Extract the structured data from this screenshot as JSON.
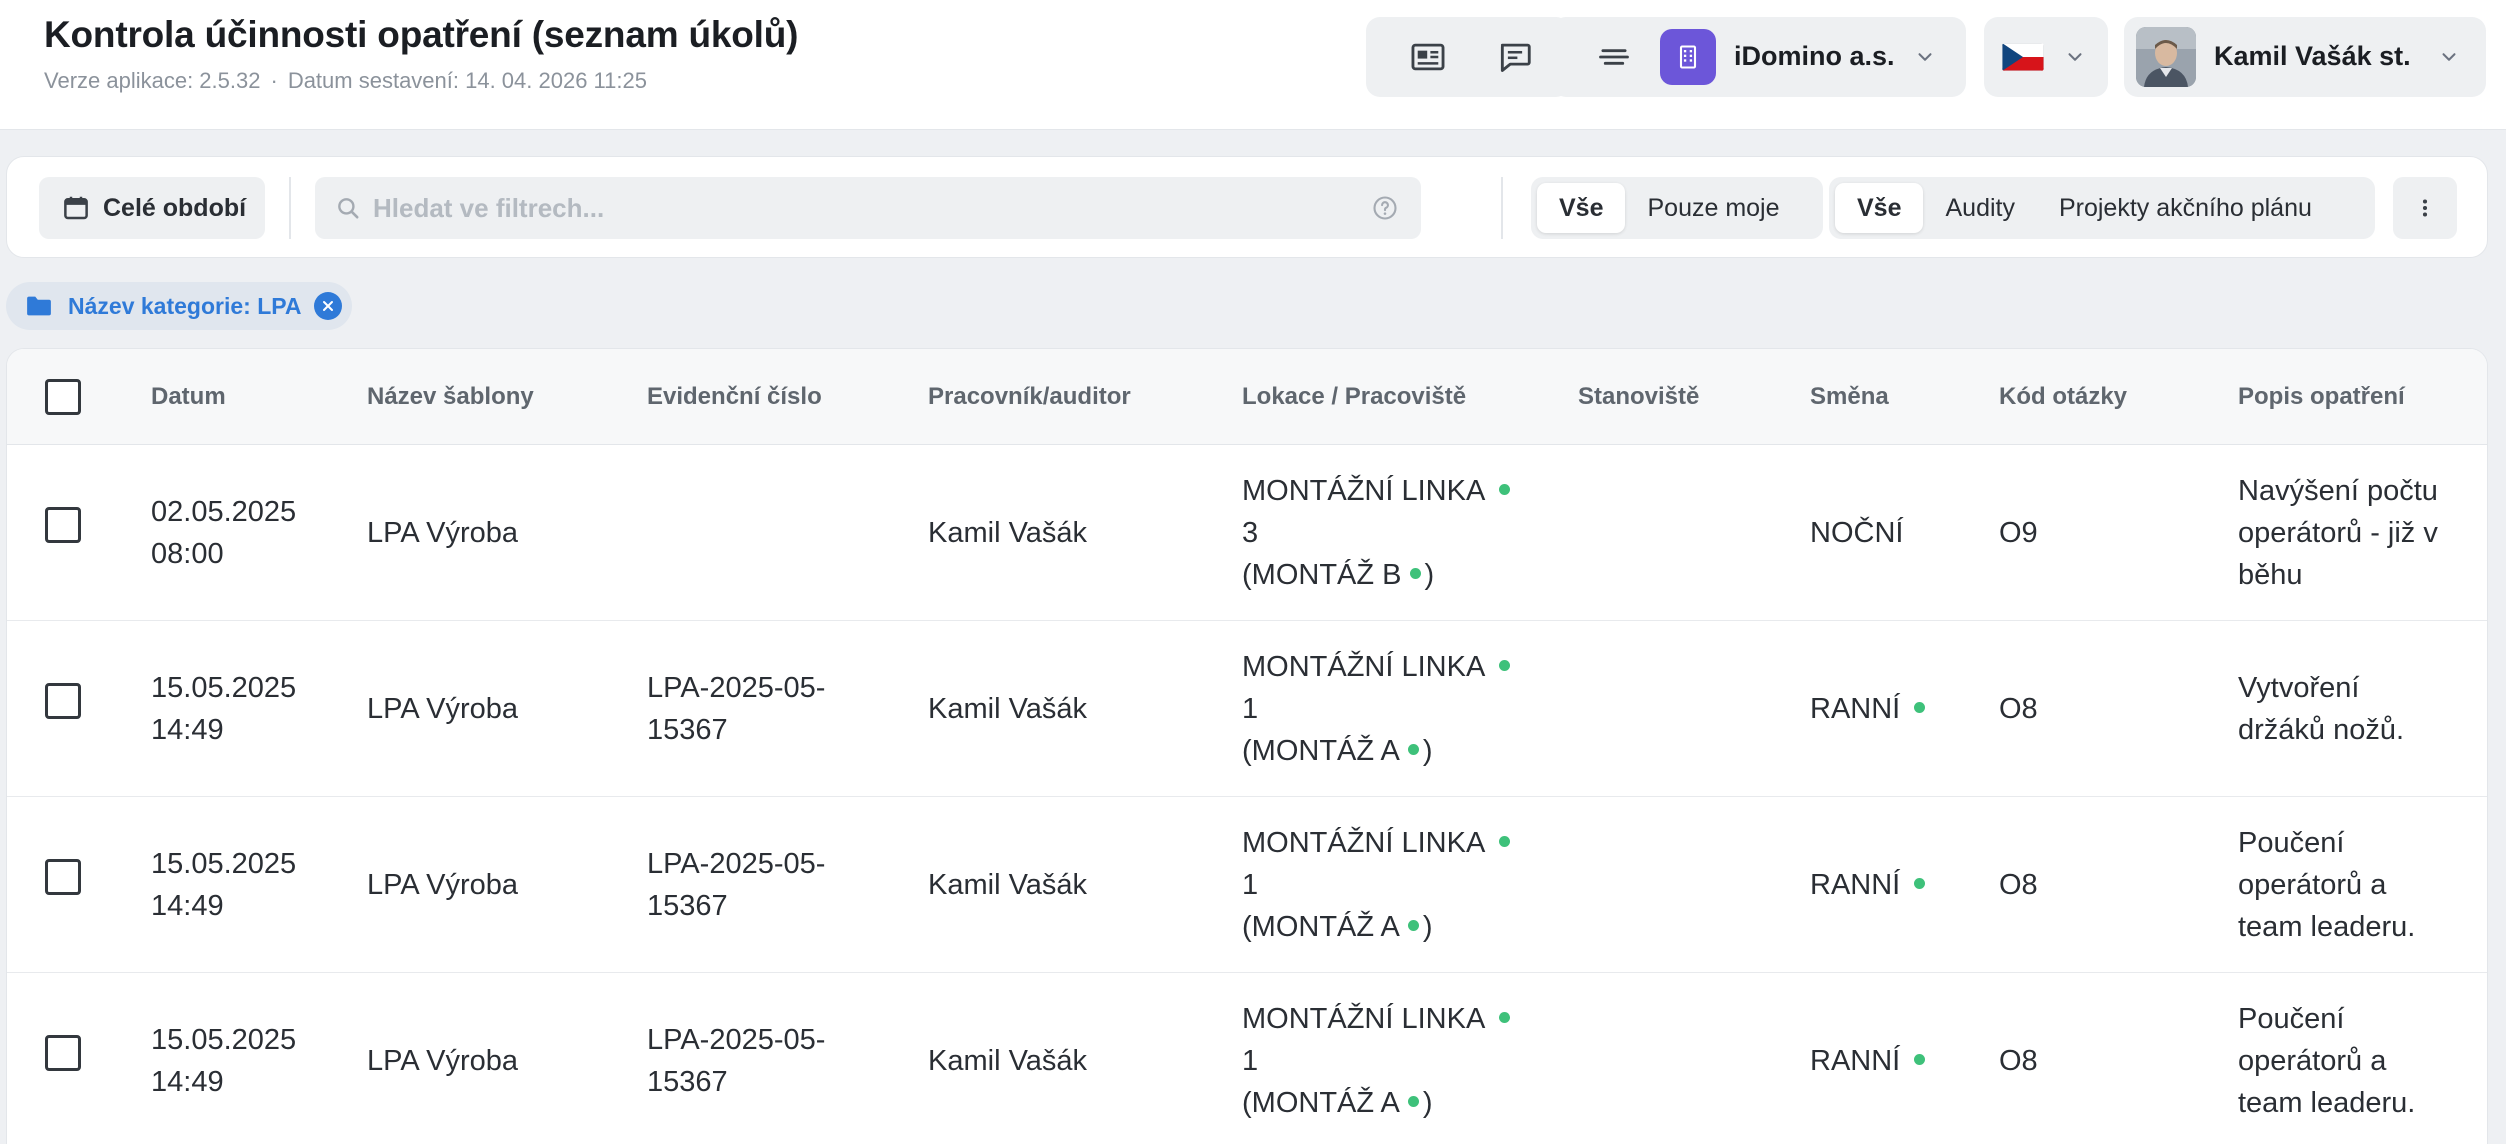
{
  "header": {
    "title": "Kontrola účinnosti opatření (seznam úkolů)",
    "app_version": "Verze aplikace: 2.5.32",
    "build_date": "Datum sestavení: 14. 04. 2026 11:25",
    "separator": "·",
    "organization": "iDomino a.s.",
    "user_name": "Kamil Vašák st.",
    "language_flag": "cz-flag-icon"
  },
  "filters": {
    "period_label": "Celé období",
    "search_placeholder": "Hledat ve filtrech...",
    "scope_toggle": [
      {
        "label": "Vše",
        "active": true
      },
      {
        "label": "Pouze moje",
        "active": false
      }
    ],
    "type_toggle": [
      {
        "label": "Vše",
        "active": true
      },
      {
        "label": "Audity",
        "active": false
      },
      {
        "label": "Projekty akčního plánu",
        "active": false
      }
    ],
    "active_chip": "Název kategorie: LPA"
  },
  "table": {
    "columns": [
      "Datum",
      "Název šablony",
      "Evidenční číslo",
      "Pracovník/auditor",
      "Lokace / Pracoviště",
      "Stanoviště",
      "Směna",
      "Kód otázky",
      "Popis opatření"
    ],
    "rows": [
      {
        "date": "02.05.2025",
        "time": "08:00",
        "template": "LPA Výroba",
        "evid_1": "",
        "evid_2": "",
        "worker": "Kamil Vašák",
        "loc_1": "MONTÁŽNÍ LINKA",
        "loc_2": "3",
        "loc_3a": "(MONTÁŽ B",
        "loc_3b": ")",
        "station": "",
        "shift": "NOČNÍ",
        "shift_dot": false,
        "code": "O9",
        "desc_1": "Navýšení počtu",
        "desc_2": "operátorů - již v",
        "desc_3": "běhu"
      },
      {
        "date": "15.05.2025",
        "time": "14:49",
        "template": "LPA Výroba",
        "evid_1": "LPA-2025-05-",
        "evid_2": "15367",
        "worker": "Kamil Vašák",
        "loc_1": "MONTÁŽNÍ LINKA",
        "loc_2": "1",
        "loc_3a": "(MONTÁŽ A",
        "loc_3b": ")",
        "station": "",
        "shift": "RANNÍ",
        "shift_dot": true,
        "code": "O8",
        "desc_1": "Vytvoření",
        "desc_2": "držáků nožů.",
        "desc_3": ""
      },
      {
        "date": "15.05.2025",
        "time": "14:49",
        "template": "LPA Výroba",
        "evid_1": "LPA-2025-05-",
        "evid_2": "15367",
        "worker": "Kamil Vašák",
        "loc_1": "MONTÁŽNÍ LINKA",
        "loc_2": "1",
        "loc_3a": "(MONTÁŽ A",
        "loc_3b": ")",
        "station": "",
        "shift": "RANNÍ",
        "shift_dot": true,
        "code": "O8",
        "desc_1": "Poučení",
        "desc_2": "operátorů a",
        "desc_3": "team leaderu."
      },
      {
        "date": "15.05.2025",
        "time": "14:49",
        "template": "LPA Výroba",
        "evid_1": "LPA-2025-05-",
        "evid_2": "15367",
        "worker": "Kamil Vašák",
        "loc_1": "MONTÁŽNÍ LINKA",
        "loc_2": "1",
        "loc_3a": "(MONTÁŽ A",
        "loc_3b": ")",
        "station": "",
        "shift": "RANNÍ",
        "shift_dot": true,
        "code": "O8",
        "desc_1": "Poučení",
        "desc_2": "operátorů a",
        "desc_3": "team leaderu."
      }
    ]
  },
  "colors": {
    "accent_blue": "#2f7ad8",
    "org_purple": "#6c56d9",
    "status_green": "#3ec17a"
  }
}
